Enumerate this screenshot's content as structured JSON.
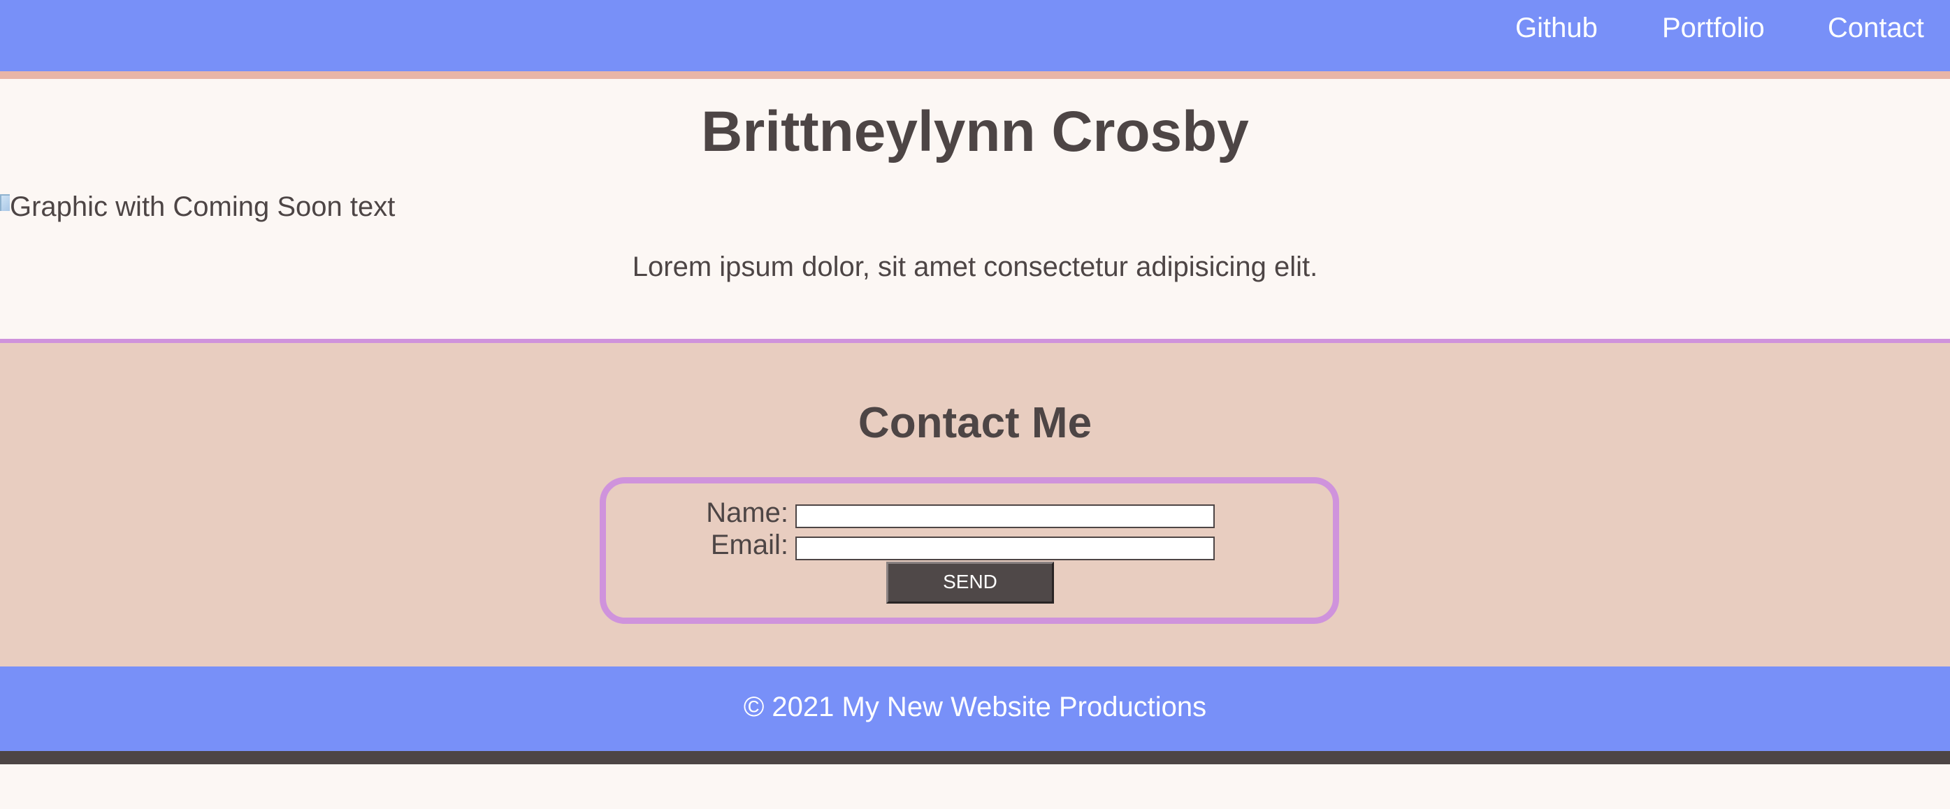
{
  "nav": {
    "links": [
      {
        "label": "Github"
      },
      {
        "label": "Portfolio"
      },
      {
        "label": "Contact"
      }
    ]
  },
  "header": {
    "title": "Brittneylynn Crosby"
  },
  "main": {
    "image_alt": "Graphic with Coming Soon text",
    "intro": "Lorem ipsum dolor, sit amet consectetur adipisicing elit."
  },
  "contact": {
    "title": "Contact Me",
    "name_label": "Name:",
    "email_label": "Email:",
    "name_value": "",
    "email_value": "",
    "send_label": "SEND"
  },
  "footer": {
    "text": "© 2021 My New Website Productions"
  },
  "colors": {
    "nav_bg": "#7890f8",
    "nav_border": "#e8b5a7",
    "page_bg": "#fcf7f4",
    "contact_bg": "#e8cdc0",
    "accent_purple": "#cf93dc",
    "text_dark": "#4d4545",
    "button_bg": "#4f4848"
  },
  "icons": {
    "broken_image": "broken-image-icon"
  }
}
